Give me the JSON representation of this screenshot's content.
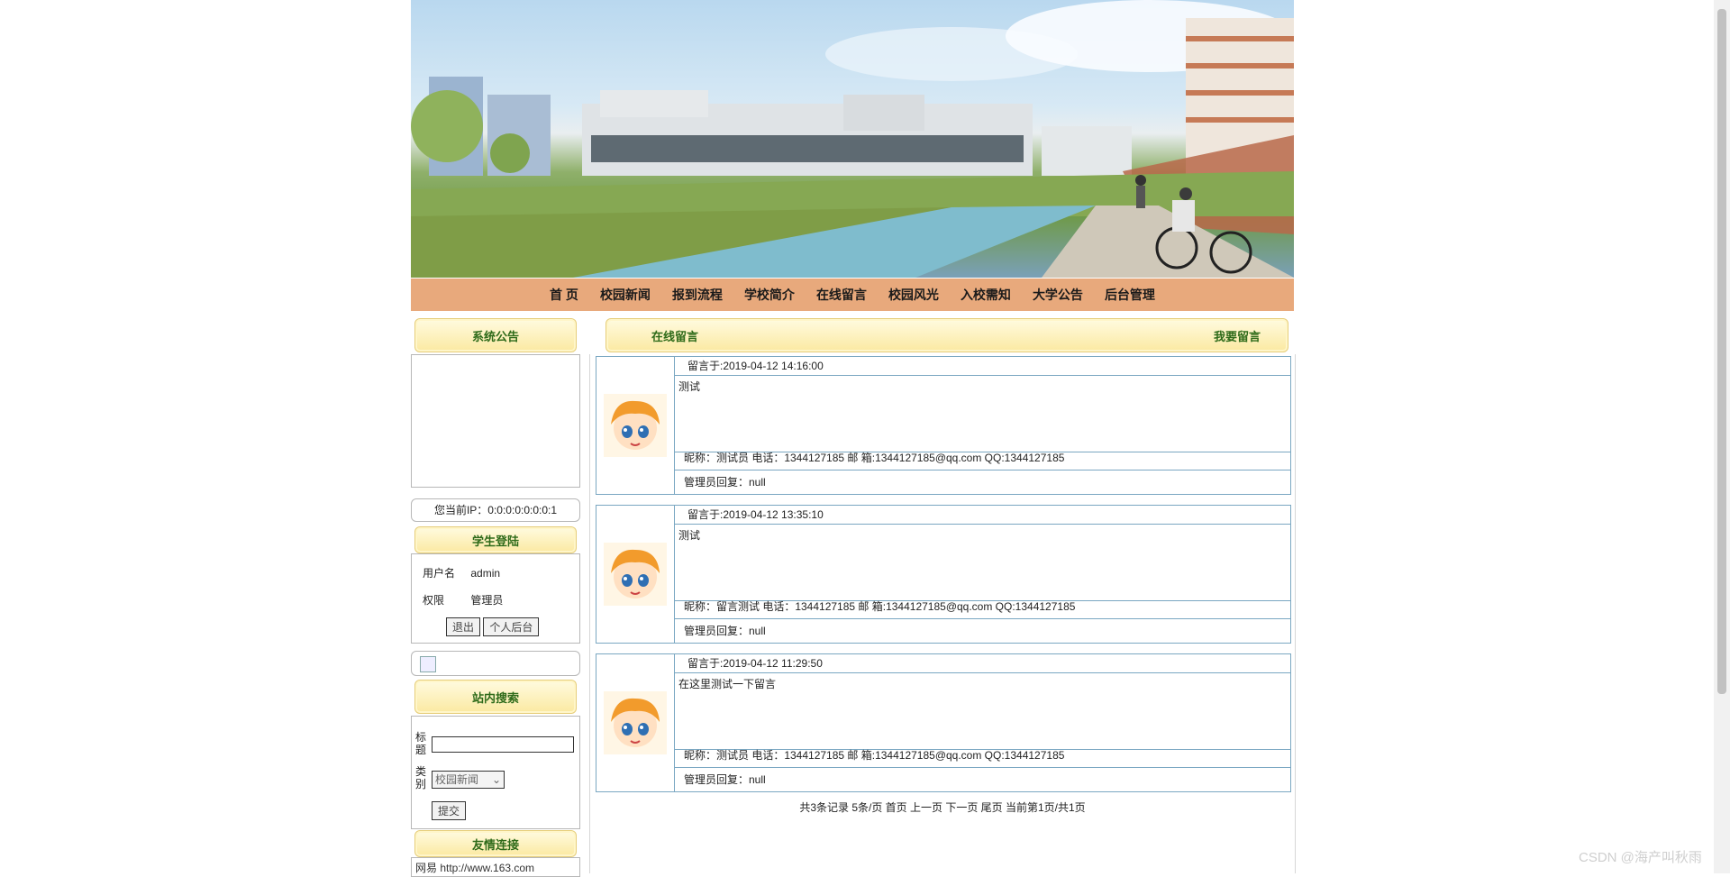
{
  "nav": {
    "items": [
      "首 页",
      "校园新闻",
      "报到流程",
      "学校简介",
      "在线留言",
      "校园风光",
      "入校需知",
      "大学公告",
      "后台管理"
    ]
  },
  "sidebar": {
    "announcement_title": "系统公告",
    "ip_text": "您当前IP：0:0:0:0:0:0:0:1",
    "login_title": "学生登陆",
    "username_label": "用户名",
    "username_value": "admin",
    "role_label": "权限",
    "role_value": "管理员",
    "logout_button": "退出",
    "personal_button": "个人后台",
    "search_title": "站内搜索",
    "search_title_label": "标题",
    "search_type_label": "类别",
    "search_type_value": "校园新闻",
    "submit_button": "提交",
    "links_title": "友情连接",
    "link_1": "网易 http://www.163.com"
  },
  "main": {
    "section_title": "在线留言",
    "write_link": "我要留言",
    "messages": [
      {
        "time": "留言于:2019-04-12 14:16:00",
        "content": "测试",
        "info": "昵称：测试员    电话：1344127185  邮 箱:1344127185@qq.com    QQ:1344127185",
        "reply": "管理员回复：null"
      },
      {
        "time": "留言于:2019-04-12 13:35:10",
        "content": "测试",
        "info": "昵称：留言测试    电话：1344127185  邮 箱:1344127185@qq.com    QQ:1344127185",
        "reply": "管理员回复：null"
      },
      {
        "time": "留言于:2019-04-12 11:29:50",
        "content": "在这里测试一下留言",
        "info": "昵称：测试员    电话：1344127185  邮 箱:1344127185@qq.com    QQ:1344127185",
        "reply": "管理员回复：null"
      }
    ],
    "pager": "共3条记录  5条/页 首页 上一页 下一页 尾页 当前第1页/共1页"
  },
  "watermark": "CSDN @海产叫秋雨",
  "colors": {
    "nav_bg": "#e8a97c",
    "title_green": "#2f6b1a",
    "border_blue": "#7aa7c2"
  }
}
